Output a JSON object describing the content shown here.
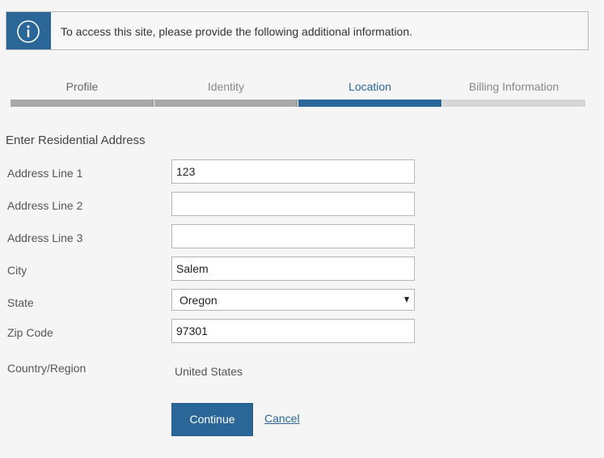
{
  "banner": {
    "icon": "info-icon",
    "message": "To access this site, please provide the following additional information."
  },
  "steps": [
    {
      "label": "Profile",
      "state": "done"
    },
    {
      "label": "Identity",
      "state": "done"
    },
    {
      "label": "Location",
      "state": "active"
    },
    {
      "label": "Billing Information",
      "state": "pending"
    }
  ],
  "form": {
    "title": "Enter Residential Address",
    "address1": {
      "label": "Address Line 1",
      "value": "123"
    },
    "address2": {
      "label": "Address Line 2",
      "value": ""
    },
    "address3": {
      "label": "Address Line 3",
      "value": ""
    },
    "city": {
      "label": "City",
      "value": "Salem"
    },
    "state": {
      "label": "State",
      "value": "Oregon"
    },
    "zip": {
      "label": "Zip Code",
      "value": "97301"
    },
    "country": {
      "label": "Country/Region",
      "value": "United States"
    }
  },
  "actions": {
    "continue_label": "Continue",
    "cancel_label": "Cancel"
  },
  "colors": {
    "accent": "#2b6699",
    "step_done": "#a8a8a8",
    "step_pending": "#d6d6d6"
  }
}
